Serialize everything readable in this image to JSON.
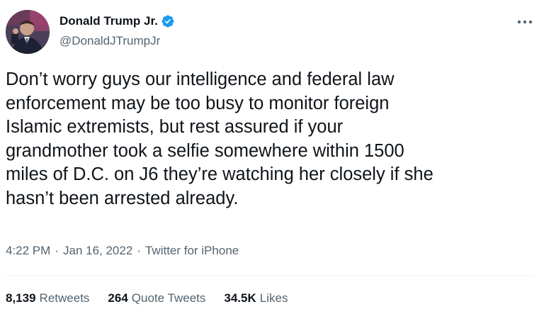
{
  "author": {
    "name": "Donald Trump Jr.",
    "handle": "@DonaldJTrumpJr",
    "verified": true,
    "verified_color": "#1d9bf0"
  },
  "tweet": {
    "text": "Don’t worry guys our intelligence and federal law\nenforcement may be too busy to monitor foreign\nIslamic extremists, but rest assured if your\ngrandmother took a selfie somewhere within 1500\nmiles of D.C. on J6 they’re watching her closely if she\nhasn’t been arrested already.",
    "time": "4:22 PM",
    "separator": "·",
    "date": "Jan 16, 2022",
    "source": "Twitter for iPhone"
  },
  "stats": {
    "retweets_count": "8,139",
    "retweets_label": "Retweets",
    "quotes_count": "264",
    "quotes_label": "Quote Tweets",
    "likes_count": "34.5K",
    "likes_label": "Likes"
  },
  "icons": {
    "more": "more-options-icon",
    "verified": "verified-badge-icon"
  }
}
